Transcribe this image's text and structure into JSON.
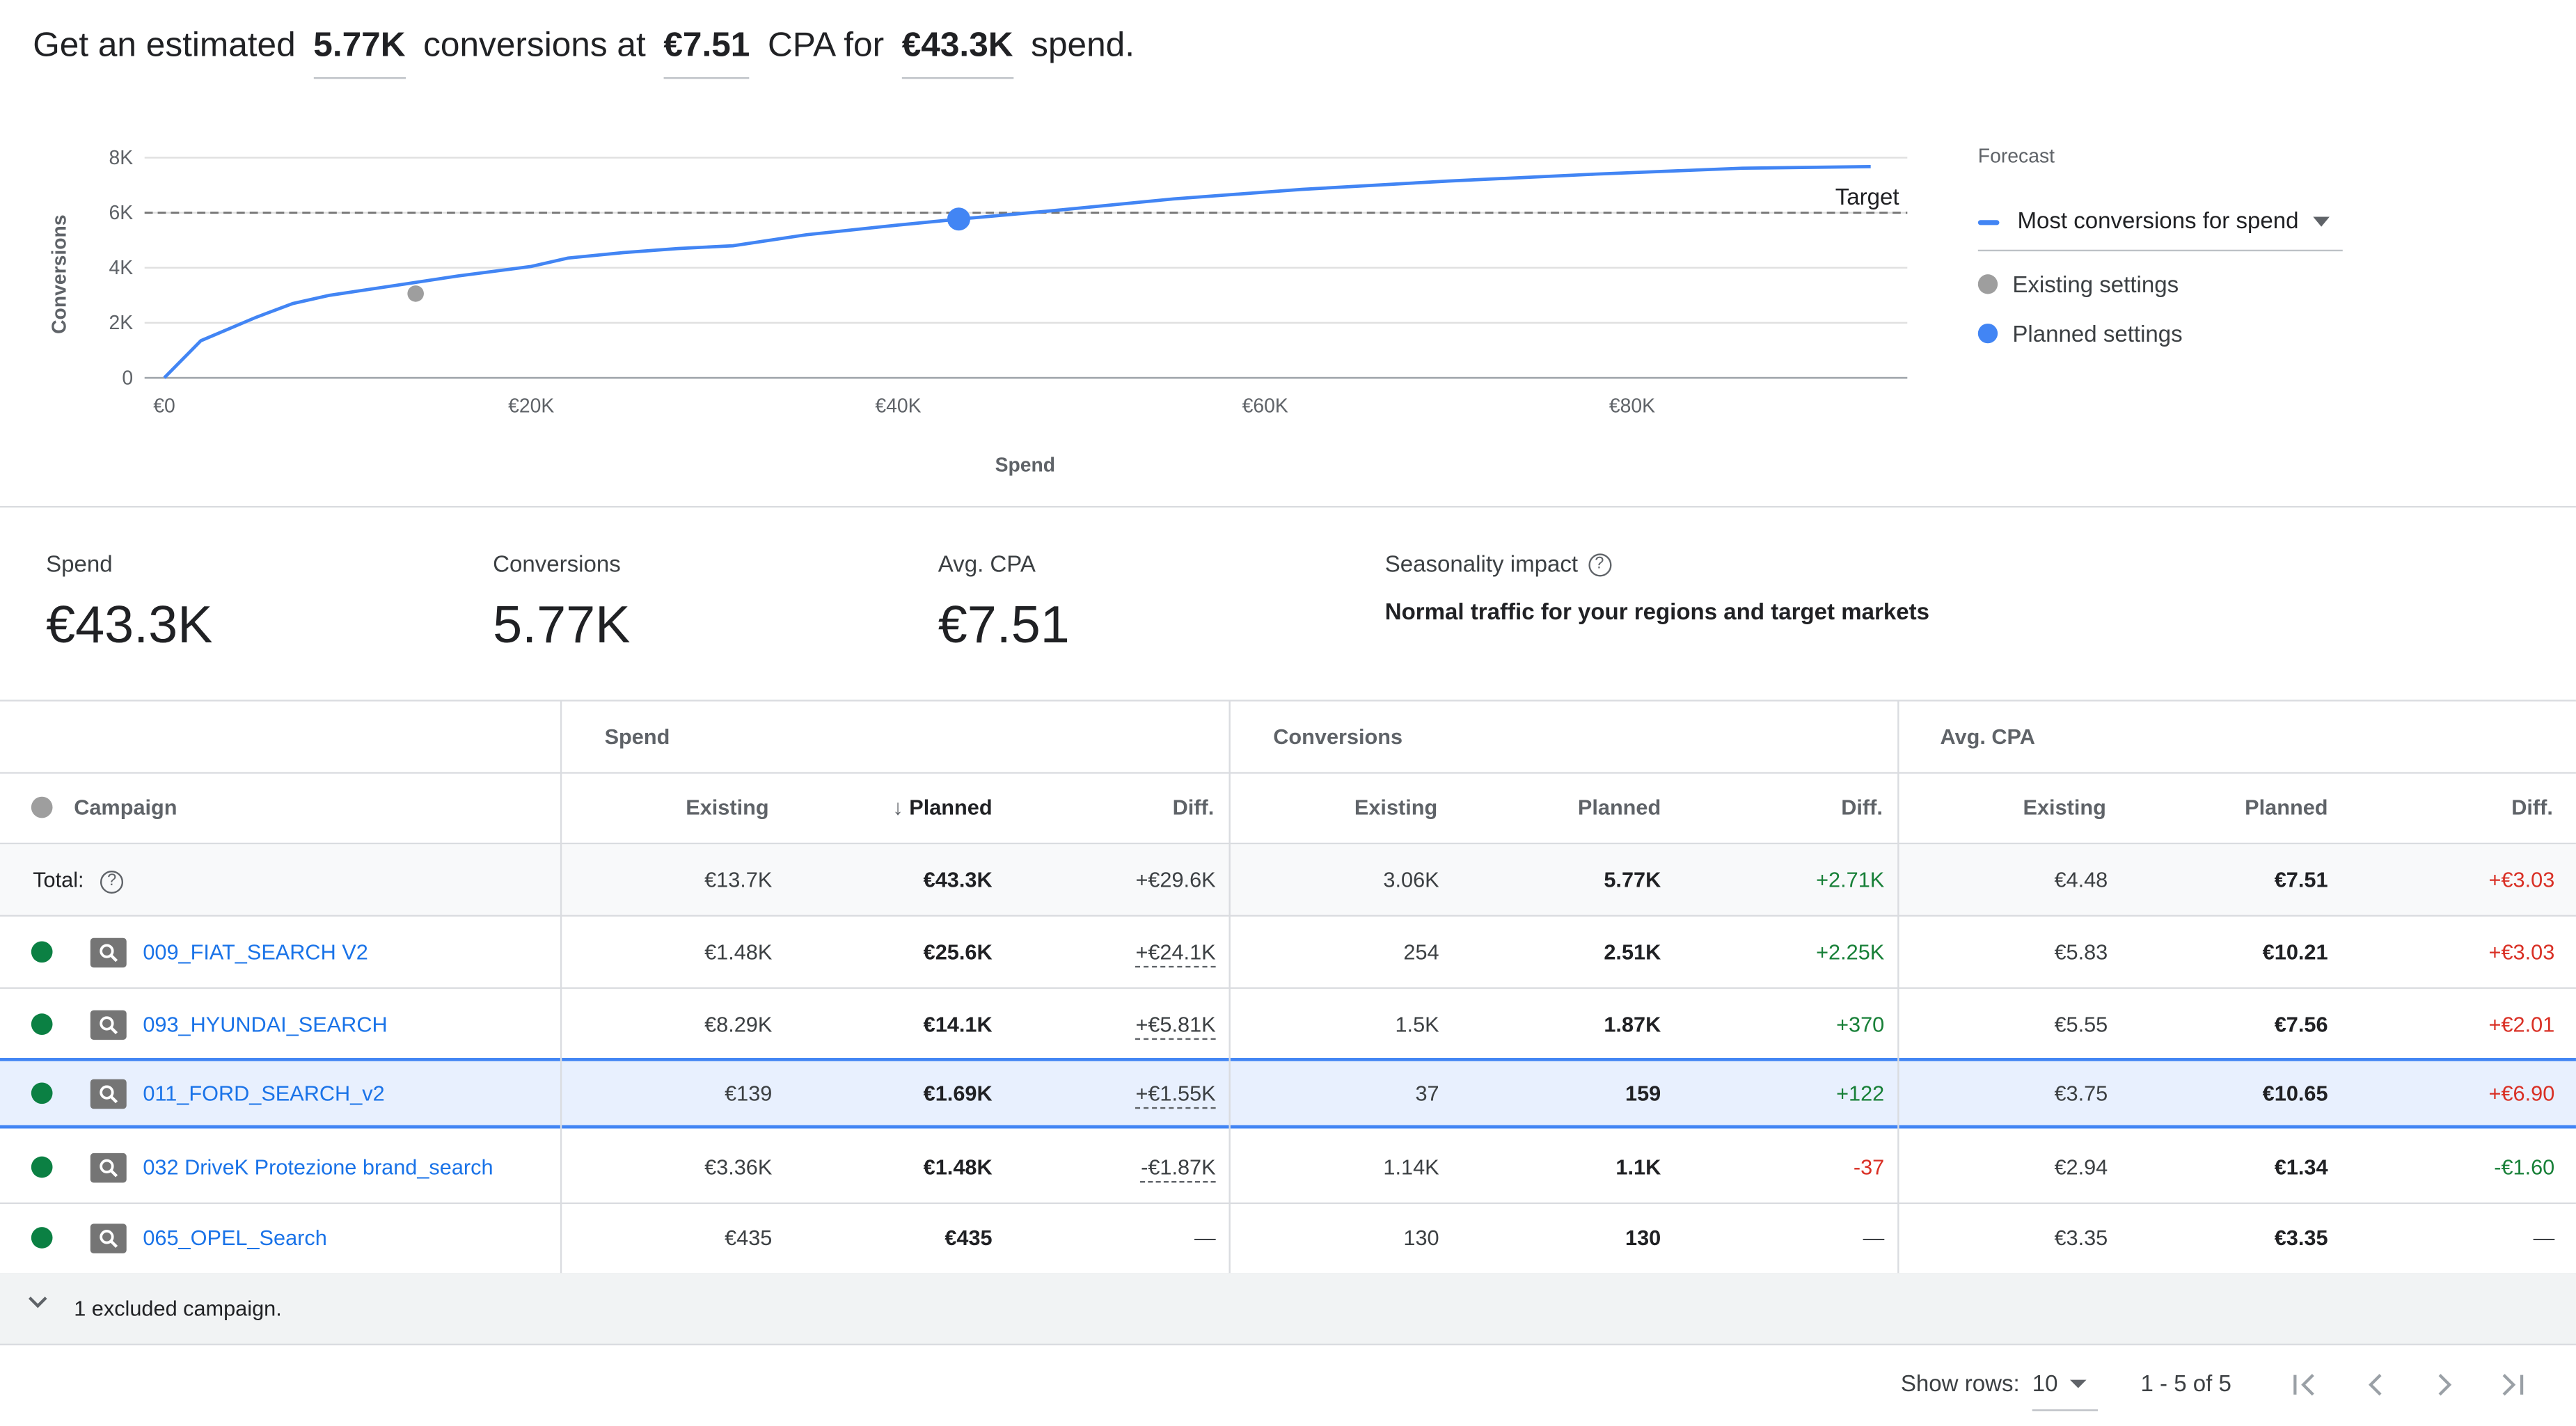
{
  "headline": {
    "prefix": "Get an estimated",
    "conversions": "5.77K",
    "mid1": "conversions at",
    "cpa": "€7.51",
    "mid2": "CPA for",
    "spend": "€43.3K",
    "suffix": "spend."
  },
  "chart_data": {
    "type": "line",
    "xlabel": "Spend",
    "ylabel": "Conversions",
    "xlim": [
      0,
      95000
    ],
    "ylim": [
      0,
      8000
    ],
    "x_ticks": [
      "€0",
      "€20K",
      "€40K",
      "€60K",
      "€80K"
    ],
    "x_tick_values": [
      0,
      20000,
      40000,
      60000,
      80000
    ],
    "y_ticks": [
      "0",
      "2K",
      "4K",
      "6K",
      "8K"
    ],
    "y_tick_values": [
      0,
      2000,
      4000,
      6000,
      8000
    ],
    "target_value": 6000,
    "target_label": "Target",
    "curve": {
      "x": [
        0,
        2000,
        5000,
        7000,
        9000,
        13000,
        16000,
        20000,
        22000,
        25000,
        28000,
        31000,
        35000,
        40000,
        43300,
        48000,
        55000,
        62000,
        70000,
        78000,
        86000,
        93000
      ],
      "y": [
        0,
        1350,
        2200,
        2700,
        3000,
        3400,
        3700,
        4050,
        4350,
        4550,
        4700,
        4800,
        5200,
        5550,
        5770,
        6050,
        6500,
        6850,
        7150,
        7400,
        7620,
        7680
      ]
    },
    "existing_point": {
      "x": 13700,
      "y": 3060
    },
    "planned_point": {
      "x": 43300,
      "y": 5770
    },
    "colors": {
      "line": "#4285f4",
      "existing": "#9e9e9e",
      "planned": "#4285f4",
      "target": "#757575"
    }
  },
  "legend": {
    "title": "Forecast",
    "selected": "Most conversions for spend",
    "items": [
      "Existing settings",
      "Planned settings"
    ]
  },
  "stats": {
    "spend_label": "Spend",
    "spend_value": "€43.3K",
    "conv_label": "Conversions",
    "conv_value": "5.77K",
    "cpa_label": "Avg. CPA",
    "cpa_value": "€7.51",
    "season_label": "Seasonality impact",
    "season_text": "Normal traffic for your regions and target markets"
  },
  "table": {
    "groups": [
      "Spend",
      "Conversions",
      "Avg. CPA"
    ],
    "campaign_header": "Campaign",
    "sub": {
      "existing": "Existing",
      "planned": "Planned",
      "diff": "Diff."
    },
    "total": {
      "label": "Total:",
      "values": [
        "€13.7K",
        "€43.3K",
        "+€29.6K",
        "3.06K",
        "5.77K",
        "+2.71K",
        "€4.48",
        "€7.51",
        "+€3.03"
      ]
    },
    "rows": [
      {
        "name": "009_FIAT_SEARCH V2",
        "values": [
          "€1.48K",
          "€25.6K",
          "+€24.1K",
          "254",
          "2.51K",
          "+2.25K",
          "€5.83",
          "€10.21",
          "+€3.03"
        ]
      },
      {
        "name": "093_HYUNDAI_SEARCH",
        "values": [
          "€8.29K",
          "€14.1K",
          "+€5.81K",
          "1.5K",
          "1.87K",
          "+370",
          "€5.55",
          "€7.56",
          "+€2.01"
        ]
      },
      {
        "name": "011_FORD_SEARCH_v2",
        "values": [
          "€139",
          "€1.69K",
          "+€1.55K",
          "37",
          "159",
          "+122",
          "€3.75",
          "€10.65",
          "+€6.90"
        ]
      },
      {
        "name": "032 DriveK Protezione brand_search",
        "values": [
          "€3.36K",
          "€1.48K",
          "-€1.87K",
          "1.14K",
          "1.1K",
          "-37",
          "€2.94",
          "€1.34",
          "-€1.60"
        ]
      },
      {
        "name": "065_OPEL_Search",
        "values": [
          "€435",
          "€435",
          "—",
          "130",
          "130",
          "—",
          "€3.35",
          "€3.35",
          "—"
        ]
      }
    ],
    "excluded": "1 excluded campaign."
  },
  "footer": {
    "show_rows_label": "Show rows:",
    "rows_value": "10",
    "range": "1 - 5 of 5"
  },
  "colors": {
    "link": "#1a73e8",
    "positive": "#188038",
    "negative": "#d93025",
    "status_green": "#0b8043",
    "status_gray": "#9e9e9e",
    "selected_row": "#e8f0fe"
  }
}
